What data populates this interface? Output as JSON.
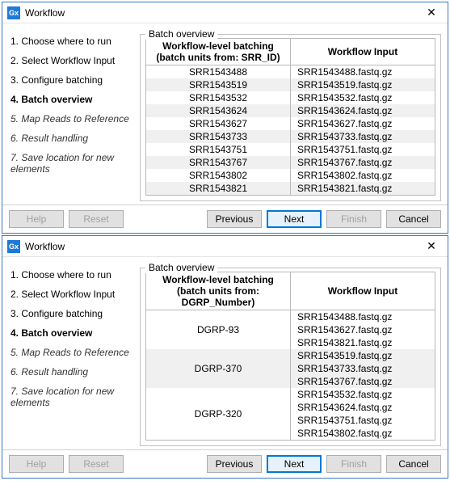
{
  "windows": [
    {
      "app_icon_text": "Gx",
      "title": "Workflow",
      "steps": [
        {
          "label": "1.  Choose where to run",
          "style": ""
        },
        {
          "label": "2.  Select Workflow Input",
          "style": ""
        },
        {
          "label": "3.  Configure batching",
          "style": ""
        },
        {
          "label": "4.  Batch overview",
          "style": "bold"
        },
        {
          "label": "5.  Map Reads to Reference",
          "style": "italic"
        },
        {
          "label": "6.  Result handling",
          "style": "italic"
        },
        {
          "label": "7.  Save location for new elements",
          "style": "italic"
        }
      ],
      "group_label": "Batch overview",
      "col1_line1": "Workflow-level batching",
      "col1_line2": "(batch units from: SRR_ID)",
      "col2": "Workflow Input",
      "rows": [
        {
          "batch": "SRR1543488",
          "inputs": [
            "SRR1543488.fastq.gz"
          ]
        },
        {
          "batch": "SRR1543519",
          "inputs": [
            "SRR1543519.fastq.gz"
          ]
        },
        {
          "batch": "SRR1543532",
          "inputs": [
            "SRR1543532.fastq.gz"
          ]
        },
        {
          "batch": "SRR1543624",
          "inputs": [
            "SRR1543624.fastq.gz"
          ]
        },
        {
          "batch": "SRR1543627",
          "inputs": [
            "SRR1543627.fastq.gz"
          ]
        },
        {
          "batch": "SRR1543733",
          "inputs": [
            "SRR1543733.fastq.gz"
          ]
        },
        {
          "batch": "SRR1543751",
          "inputs": [
            "SRR1543751.fastq.gz"
          ]
        },
        {
          "batch": "SRR1543767",
          "inputs": [
            "SRR1543767.fastq.gz"
          ]
        },
        {
          "batch": "SRR1543802",
          "inputs": [
            "SRR1543802.fastq.gz"
          ]
        },
        {
          "batch": "SRR1543821",
          "inputs": [
            "SRR1543821.fastq.gz"
          ]
        }
      ],
      "buttons": {
        "help": "Help",
        "reset": "Reset",
        "previous": "Previous",
        "next": "Next",
        "finish": "Finish",
        "cancel": "Cancel"
      }
    },
    {
      "app_icon_text": "Gx",
      "title": "Workflow",
      "steps": [
        {
          "label": "1.  Choose where to run",
          "style": ""
        },
        {
          "label": "2.  Select Workflow Input",
          "style": ""
        },
        {
          "label": "3.  Configure batching",
          "style": ""
        },
        {
          "label": "4.  Batch overview",
          "style": "bold"
        },
        {
          "label": "5.  Map Reads to Reference",
          "style": "italic"
        },
        {
          "label": "6.  Result handling",
          "style": "italic"
        },
        {
          "label": "7.  Save location for new elements",
          "style": "italic"
        }
      ],
      "group_label": "Batch overview",
      "col1_line1": "Workflow-level batching",
      "col1_line2": "(batch units from: DGRP_Number)",
      "col2": "Workflow Input",
      "rows": [
        {
          "batch": "DGRP-93",
          "inputs": [
            "SRR1543488.fastq.gz",
            "SRR1543627.fastq.gz",
            "SRR1543821.fastq.gz"
          ]
        },
        {
          "batch": "DGRP-370",
          "inputs": [
            "SRR1543519.fastq.gz",
            "SRR1543733.fastq.gz",
            "SRR1543767.fastq.gz"
          ]
        },
        {
          "batch": "DGRP-320",
          "inputs": [
            "SRR1543532.fastq.gz",
            "SRR1543624.fastq.gz",
            "SRR1543751.fastq.gz",
            "SRR1543802.fastq.gz"
          ]
        }
      ],
      "buttons": {
        "help": "Help",
        "reset": "Reset",
        "previous": "Previous",
        "next": "Next",
        "finish": "Finish",
        "cancel": "Cancel"
      }
    }
  ]
}
